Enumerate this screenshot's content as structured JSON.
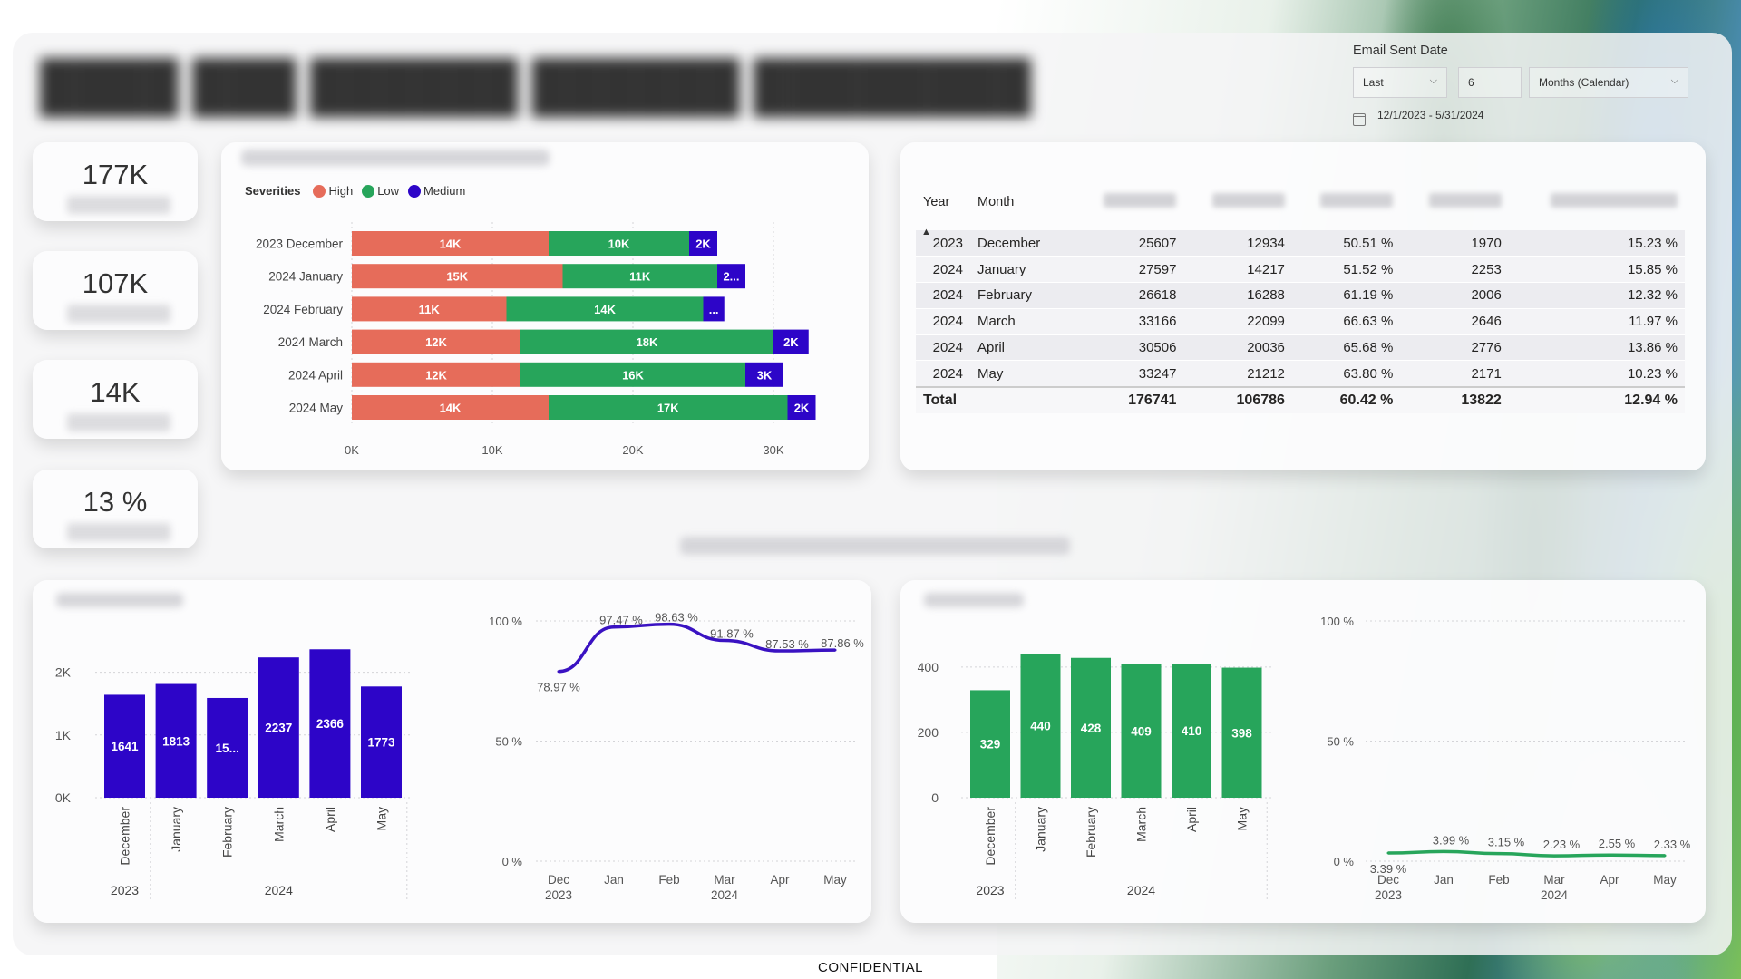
{
  "footer": "CONFIDENTIAL",
  "colors": {
    "high": "#E66C5A",
    "low": "#27A55B",
    "medium": "#2D05C8",
    "line": "#3A12C2"
  },
  "kpis": [
    {
      "value": "177K"
    },
    {
      "value": "107K"
    },
    {
      "value": "14K"
    },
    {
      "value": "13 %"
    }
  ],
  "slicer": {
    "title": "Email Sent Date",
    "relative": "Last",
    "count": "6",
    "unit": "Months (Calendar)",
    "range": "12/1/2023 - 5/31/2024"
  },
  "chart_data": [
    {
      "type": "bar",
      "orientation": "horizontal",
      "stacked": true,
      "legend_title": "Severities",
      "legend_position": "top-left",
      "categories": [
        "2023 December",
        "2024 January",
        "2024 February",
        "2024 March",
        "2024 April",
        "2024 May"
      ],
      "series": [
        {
          "name": "High",
          "values": [
            14000,
            15000,
            11000,
            12000,
            12000,
            14000
          ],
          "labels": [
            "14K",
            "15K",
            "11K",
            "12K",
            "12K",
            "14K"
          ]
        },
        {
          "name": "Low",
          "values": [
            10000,
            11000,
            14000,
            18000,
            16000,
            17000
          ],
          "labels": [
            "10K",
            "11K",
            "14K",
            "18K",
            "16K",
            "17K"
          ]
        },
        {
          "name": "Medium",
          "values": [
            2000,
            2000,
            1500,
            2500,
            2700,
            2000
          ],
          "labels": [
            "2K",
            "2...",
            "...",
            "2K",
            "3K",
            "2K"
          ]
        }
      ],
      "xlim": [
        0,
        33000
      ],
      "xticks": [
        "0K",
        "10K",
        "20K",
        "30K"
      ],
      "grid": true
    },
    {
      "type": "bar",
      "categories": [
        "December",
        "January",
        "February",
        "March",
        "April",
        "May"
      ],
      "groups": [
        {
          "label": "2023",
          "span": 1
        },
        {
          "label": "2024",
          "span": 5
        }
      ],
      "values": [
        1641,
        1813,
        1590,
        2237,
        2366,
        1773
      ],
      "labels": [
        "1641",
        "1813",
        "15...",
        "2237",
        "2366",
        "1773"
      ],
      "ylim": [
        0,
        2500
      ],
      "yticks": [
        "0K",
        "1K",
        "2K"
      ]
    },
    {
      "type": "line",
      "x": [
        "Dec",
        "Jan",
        "Feb",
        "Mar",
        "Apr",
        "May"
      ],
      "x_years": [
        "2023",
        "",
        "",
        "2024",
        "",
        ""
      ],
      "values": [
        78.97,
        97.47,
        98.63,
        91.87,
        87.53,
        87.86
      ],
      "labels": [
        "78.97 %",
        "97.47 %",
        "98.63 %",
        "91.87 %",
        "87.53 %",
        "87.86 %"
      ],
      "ylim": [
        0,
        100
      ],
      "yticks": [
        "0 %",
        "50 %",
        "100 %"
      ]
    },
    {
      "type": "bar",
      "categories": [
        "December",
        "January",
        "February",
        "March",
        "April",
        "May"
      ],
      "groups": [
        {
          "label": "2023",
          "span": 1
        },
        {
          "label": "2024",
          "span": 5
        }
      ],
      "values": [
        329,
        440,
        428,
        409,
        410,
        398
      ],
      "labels": [
        "329",
        "440",
        "428",
        "409",
        "410",
        "398"
      ],
      "ylim": [
        0,
        480
      ],
      "yticks": [
        "0",
        "200",
        "400"
      ]
    },
    {
      "type": "line",
      "x": [
        "Dec",
        "Jan",
        "Feb",
        "Mar",
        "Apr",
        "May"
      ],
      "x_years": [
        "2023",
        "",
        "",
        "2024",
        "",
        ""
      ],
      "values": [
        3.39,
        3.99,
        3.15,
        2.23,
        2.55,
        2.33
      ],
      "labels": [
        "3.39 %",
        "3.99 %",
        "3.15 %",
        "2.23 %",
        "2.55 %",
        "2.33 %"
      ],
      "ylim": [
        0,
        100
      ],
      "yticks": [
        "0 %",
        "50 %",
        "100 %"
      ]
    }
  ],
  "table": {
    "headers": [
      "Year",
      "Month"
    ],
    "rows": [
      [
        "2023",
        "December",
        "25607",
        "12934",
        "50.51 %",
        "1970",
        "15.23 %"
      ],
      [
        "2024",
        "January",
        "27597",
        "14217",
        "51.52 %",
        "2253",
        "15.85 %"
      ],
      [
        "2024",
        "February",
        "26618",
        "16288",
        "61.19 %",
        "2006",
        "12.32 %"
      ],
      [
        "2024",
        "March",
        "33166",
        "22099",
        "66.63 %",
        "2646",
        "11.97 %"
      ],
      [
        "2024",
        "April",
        "30506",
        "20036",
        "65.68 %",
        "2776",
        "13.86 %"
      ],
      [
        "2024",
        "May",
        "33247",
        "21212",
        "63.80 %",
        "2171",
        "10.23 %"
      ]
    ],
    "total": [
      "Total",
      "176741",
      "106786",
      "60.42 %",
      "13822",
      "12.94 %"
    ]
  }
}
